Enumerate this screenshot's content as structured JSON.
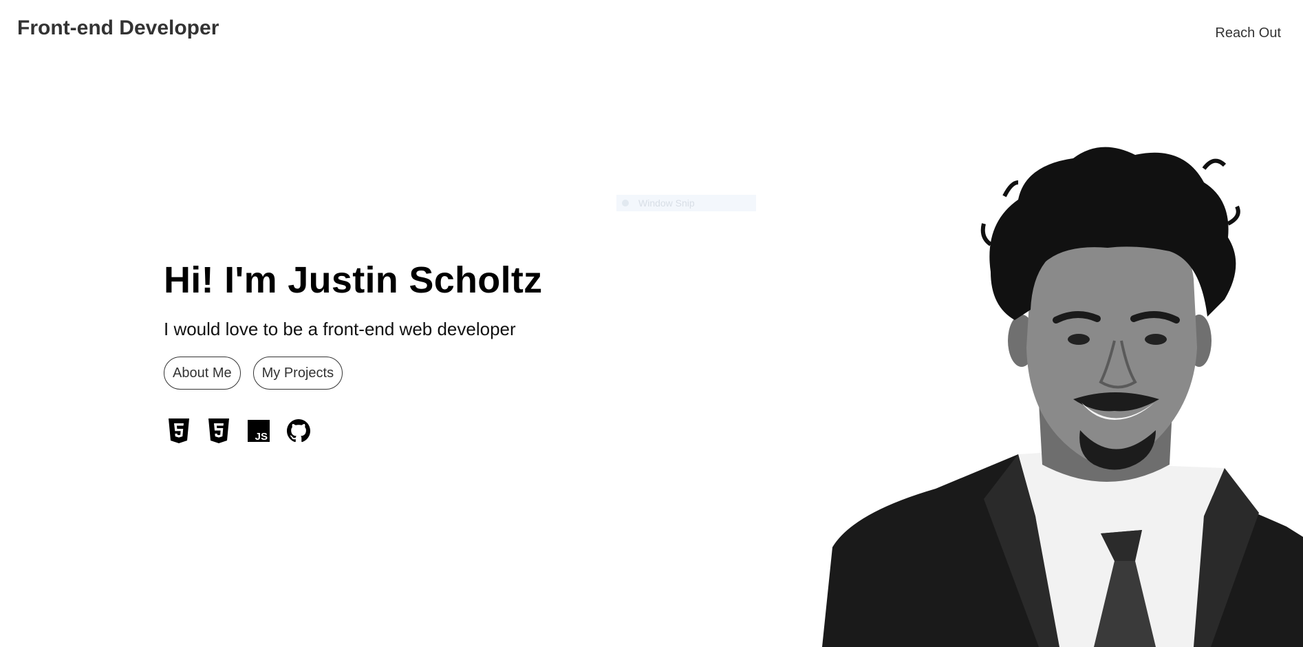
{
  "header": {
    "brand": "Front-end Developer",
    "nav_link": "Reach Out"
  },
  "overlay": {
    "label": "Window Snip"
  },
  "hero": {
    "title": "Hi! I'm Justin Scholtz",
    "subtitle": "I would love to be a front-end web developer",
    "buttons": [
      {
        "label": "About Me"
      },
      {
        "label": "My Projects"
      }
    ],
    "tech_icons": [
      {
        "name": "html5-icon"
      },
      {
        "name": "css3-icon"
      },
      {
        "name": "javascript-icon",
        "text": "JS"
      },
      {
        "name": "github-icon"
      }
    ]
  },
  "colors": {
    "text_dark": "#333333",
    "heading": "#000000",
    "background": "#ffffff"
  }
}
